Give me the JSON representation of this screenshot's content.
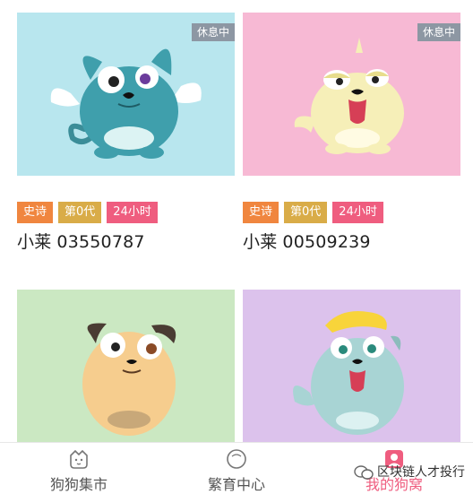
{
  "cards": [
    {
      "status": "休息中",
      "tags": [
        "史诗",
        "第0代",
        "24小时"
      ],
      "name": "小莱",
      "id": "03550787",
      "bg": "#b8e6ee"
    },
    {
      "status": "休息中",
      "tags": [
        "史诗",
        "第0代",
        "24小时"
      ],
      "name": "小莱",
      "id": "00509239",
      "bg": "#f7b9d4"
    },
    {
      "status": "",
      "tags": [],
      "name": "",
      "id": "",
      "bg": "#cbe8c2"
    },
    {
      "status": "",
      "tags": [],
      "name": "",
      "id": "",
      "bg": "#dcc2ec"
    }
  ],
  "tag_colors": [
    "#f0863f",
    "#d9ac48",
    "#ef5d7f"
  ],
  "tabbar": {
    "tabs": [
      {
        "label": "狗狗集市",
        "icon": "dog-face-icon"
      },
      {
        "label": "繁育中心",
        "icon": "circle-icon"
      },
      {
        "label": "我的狗窝",
        "icon": "profile-icon"
      }
    ],
    "active_tab": 2,
    "accent": "#ef5d7f"
  },
  "watermark": {
    "text": "区块链人才投行",
    "icon": "wechat-icon"
  }
}
